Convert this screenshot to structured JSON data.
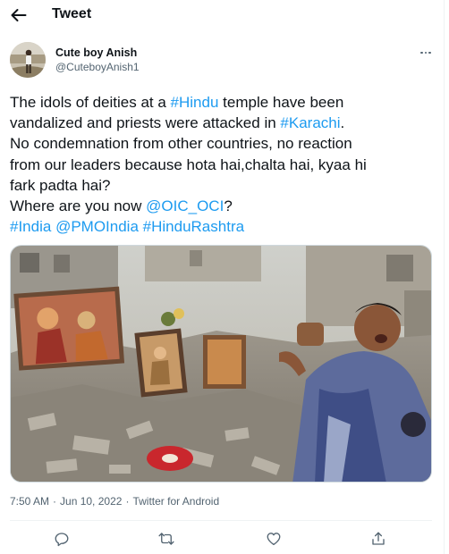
{
  "header": {
    "title": "Tweet",
    "back_icon": "arrow-left-icon"
  },
  "author": {
    "name": "Cute boy Anish",
    "handle": "@CuteboyAnish1"
  },
  "tweet": {
    "lines": [
      [
        {
          "t": "The idols of deities at a "
        },
        {
          "t": "#Hindu",
          "link": true
        },
        {
          "t": " temple have been"
        }
      ],
      [
        {
          "t": "vandalized and priests were attacked in "
        },
        {
          "t": "#Karachi",
          "link": true
        },
        {
          "t": "."
        }
      ],
      [
        {
          "t": "No condemnation from other countries, no reaction"
        }
      ],
      [
        {
          "t": "from our leaders because hota hai,chalta hai, kyaa hi"
        }
      ],
      [
        {
          "t": "fark padta hai?"
        }
      ],
      [
        {
          "t": "Where are you now "
        },
        {
          "t": "@OIC_OCI",
          "link": true
        },
        {
          "t": "?"
        }
      ],
      [
        {
          "t": "#India",
          "link": true
        },
        {
          "t": " "
        },
        {
          "t": "@PMOIndia",
          "link": true
        },
        {
          "t": " "
        },
        {
          "t": "#HinduRashtra",
          "link": true
        }
      ]
    ],
    "time": "7:50 AM",
    "date": "Jun 10, 2022",
    "separator": "·",
    "source": "Twitter for Android"
  },
  "actions": {
    "icons": [
      "reply-icon",
      "retweet-icon",
      "like-icon",
      "share-icon"
    ]
  },
  "colors": {
    "text": "#0f1419",
    "secondary": "#536471",
    "link": "#1d9bf0",
    "border": "#cfd9de"
  }
}
